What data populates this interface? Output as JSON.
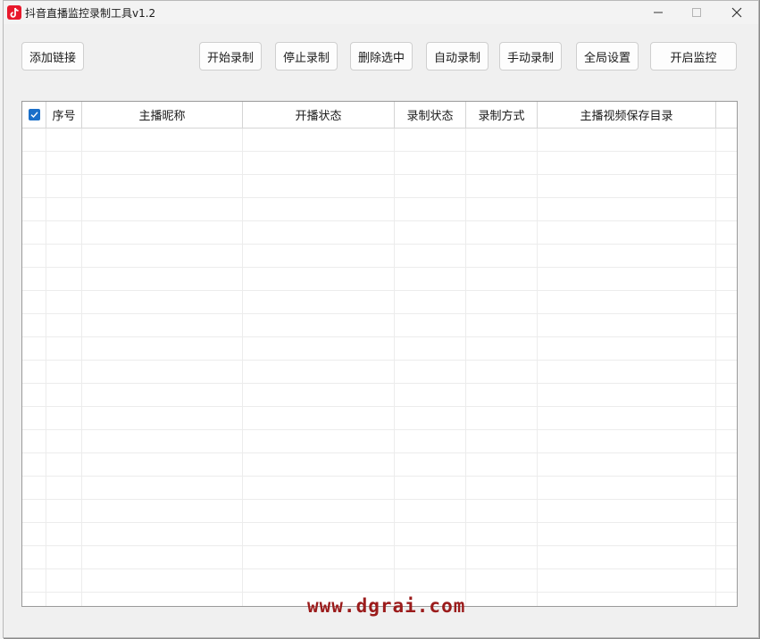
{
  "window": {
    "title": "抖音直播监控录制工具v1.2",
    "icon": "douyin-app-icon"
  },
  "toolbar": {
    "add_link": "添加链接",
    "start_record": "开始录制",
    "stop_record": "停止录制",
    "delete_selected": "删除选中",
    "auto_record": "自动录制",
    "manual_record": "手动录制",
    "global_settings": "全局设置",
    "start_monitor": "开启监控"
  },
  "table": {
    "select_all_checked": true,
    "columns": [
      "序号",
      "主播昵称",
      "开播状态",
      "录制状态",
      "录制方式",
      "主播视频保存目录"
    ],
    "rows": []
  },
  "watermark": "www.dgrai.com",
  "colors": {
    "checkbox": "#1a6fc9",
    "app_icon": "#e8192c",
    "watermark": "#9b1b1b"
  }
}
